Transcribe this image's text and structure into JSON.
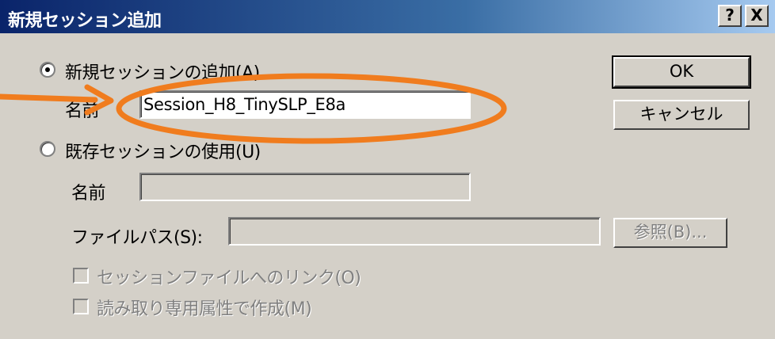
{
  "window": {
    "title": "新規セッション追加",
    "help_label": "?",
    "close_label": "X"
  },
  "options": {
    "new_session": {
      "label": "新規セッションの追加(A)",
      "selected": true,
      "name_label": "名前",
      "name_value": "Session_H8_TinySLP_E8a"
    },
    "existing_session": {
      "label": "既存セッションの使用(U)",
      "selected": false,
      "name_label": "名前",
      "name_value": "",
      "filepath_label": "ファイルパス(S):",
      "filepath_value": ""
    }
  },
  "buttons": {
    "ok": "OK",
    "cancel": "キャンセル",
    "browse": "参照(B)..."
  },
  "checkboxes": {
    "link_session_file": {
      "label": "セッションファイルへのリンク(O)",
      "checked": false
    },
    "read_only": {
      "label": "読み取り専用属性で作成(M)",
      "checked": false
    }
  },
  "colors": {
    "title_bar": "#0a246a",
    "dialog_bg": "#d4d0c8",
    "annotation": "#f07c1e"
  }
}
